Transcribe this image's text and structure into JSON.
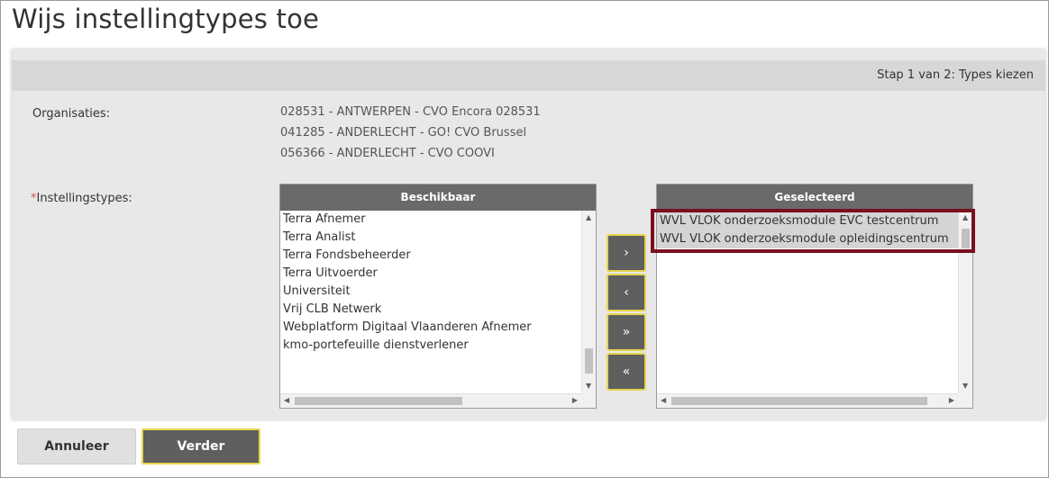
{
  "page": {
    "title": "Wijs instellingtypes toe",
    "step": "Stap 1 van 2: Types kiezen"
  },
  "form": {
    "organisations_label": "Organisaties:",
    "organisations": [
      "028531 - ANTWERPEN - CVO Encora 028531",
      "041285 - ANDERLECHT - GO! CVO Brussel",
      "056366 - ANDERLECHT - CVO COOVI"
    ],
    "required_marker": "*",
    "types_label": "Instellingstypes:"
  },
  "available": {
    "header": "Beschikbaar",
    "items": [
      "Terra Afnemer",
      "Terra Analist",
      "Terra Fondsbeheerder",
      "Terra Uitvoerder",
      "Universiteit",
      "Vrij CLB Netwerk",
      "Webplatform Digitaal Vlaanderen Afnemer",
      "kmo-portefeuille dienstverlener"
    ]
  },
  "selected": {
    "header": "Geselecteerd",
    "items": [
      "WVL VLOK onderzoeksmodule EVC testcentrum",
      "WVL VLOK onderzoeksmodule opleidingscentrum"
    ]
  },
  "move_buttons": {
    "add": "›",
    "remove": "‹",
    "add_all": "»",
    "remove_all": "«"
  },
  "footer": {
    "cancel": "Annuleer",
    "next": "Verder"
  },
  "colors": {
    "accent_border": "#e8d44d",
    "dark_button": "#5f5f5f",
    "highlight": "#7b0f1e",
    "required": "#d9534f"
  }
}
